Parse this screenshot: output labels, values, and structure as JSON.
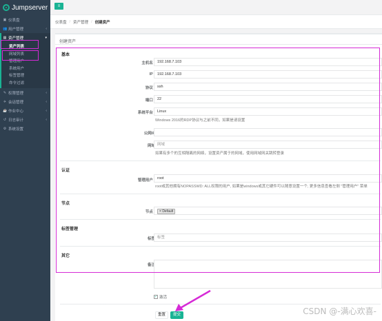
{
  "app": {
    "brand": "Jumpserver"
  },
  "sidebar": {
    "items": [
      {
        "icon": "dashboard-icon",
        "glyph": "▣",
        "label": "仪表盘",
        "chevron": false
      },
      {
        "icon": "users-icon",
        "glyph": "👥",
        "label": "用户管理",
        "chevron": true
      },
      {
        "icon": "inbox-icon",
        "glyph": "▤",
        "label": "资产管理",
        "chevron": true,
        "expanded": true,
        "children": [
          {
            "label": "资产列表",
            "active": true
          },
          {
            "label": "网域列表"
          },
          {
            "label": "管理用户"
          },
          {
            "label": "系统用户"
          },
          {
            "label": "标签管理"
          },
          {
            "label": "命令过滤"
          }
        ]
      },
      {
        "icon": "edit-icon",
        "glyph": "✎",
        "label": "权限管理",
        "chevron": true
      },
      {
        "icon": "rocket-icon",
        "glyph": "✈",
        "label": "会话管理",
        "chevron": true
      },
      {
        "icon": "coffee-icon",
        "glyph": "☕",
        "label": "作业中心",
        "chevron": true
      },
      {
        "icon": "history-icon",
        "glyph": "↺",
        "label": "日志审计",
        "chevron": true
      },
      {
        "icon": "gears-icon",
        "glyph": "⚙",
        "label": "系统设置",
        "chevron": false
      }
    ]
  },
  "topbar": {
    "menu_glyph": "≡"
  },
  "breadcrumb": [
    "仪表盘",
    "资产管理",
    "创建资产"
  ],
  "panel": {
    "title": "创建资产"
  },
  "form": {
    "sections": {
      "basic": "基本",
      "auth": "认证",
      "node": "节点",
      "labels": "标签管理",
      "other": "其它"
    },
    "hostname": {
      "label": "主机名",
      "value": "192.168.7.103",
      "required": true
    },
    "ip": {
      "label": "IP",
      "value": "192.168.7.103",
      "required": true
    },
    "protocol": {
      "label": "协议",
      "value": "ssh",
      "required": true
    },
    "port": {
      "label": "端口",
      "value": "22",
      "required": true
    },
    "platform": {
      "label": "系统平台",
      "value": "Linux",
      "required": true,
      "help": "Windows 2016的RDP协议与之前不同，如果是请设置"
    },
    "public_ip": {
      "label": "公网IP",
      "value": ""
    },
    "domain": {
      "label": "网域",
      "placeholder": "网域",
      "help": "如果有多个的互相隔离的网络，设置资产属于的网域，使用网域网关跳转登录"
    },
    "admin_user": {
      "label": "管理用户",
      "value": "root",
      "required": true,
      "help": "root或其他拥有NOPASSWD: ALL权限的用户, 如果是windows或其它硬件可以随意设置一个, 更多信息查看左侧 \"管理用户\" 菜单"
    },
    "nodes": {
      "label": "节点",
      "required": true,
      "tags": [
        "Default"
      ]
    },
    "tags": {
      "label": "标签",
      "placeholder": "标签"
    },
    "comment": {
      "label": "备注",
      "value": ""
    },
    "active": {
      "label": "激活",
      "checked": true
    }
  },
  "buttons": {
    "reset": "重置",
    "submit": "提交"
  },
  "watermark": "CSDN @-满心欢喜-"
}
